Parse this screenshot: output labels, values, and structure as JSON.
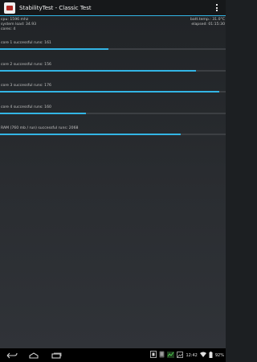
{
  "app": {
    "title": "StabilityTest - Classic Test"
  },
  "info": {
    "cpu": "cpu: 1596 mhz",
    "system_load": "system load: 34.93",
    "cores": "cores: 4",
    "batt_temp": "batt.temp.: 31.0°C",
    "elapsed": "elapsed: 01:15:30"
  },
  "runs": [
    {
      "label": "core 1 successful runs: 161",
      "progress": 0.48
    },
    {
      "label": "core 2 successful runs: 156",
      "progress": 0.87
    },
    {
      "label": "core 3 successful runs: 176",
      "progress": 0.97
    },
    {
      "label": "core 4 successful runs: 160",
      "progress": 0.38
    },
    {
      "label": "RAM (760 mb / run) successful runs: 2068",
      "progress": 0.8
    }
  ],
  "statusbar": {
    "time": "12:42",
    "battery": "92%"
  },
  "icons": {
    "app": "stability-test-app-icon",
    "overflow": "overflow-menu-icon",
    "back": "back-icon",
    "home": "home-icon",
    "recents": "recent-apps-icon"
  },
  "colors": {
    "accent": "#33b5e5",
    "actionbar": "#16181a",
    "navbar": "#000000"
  }
}
